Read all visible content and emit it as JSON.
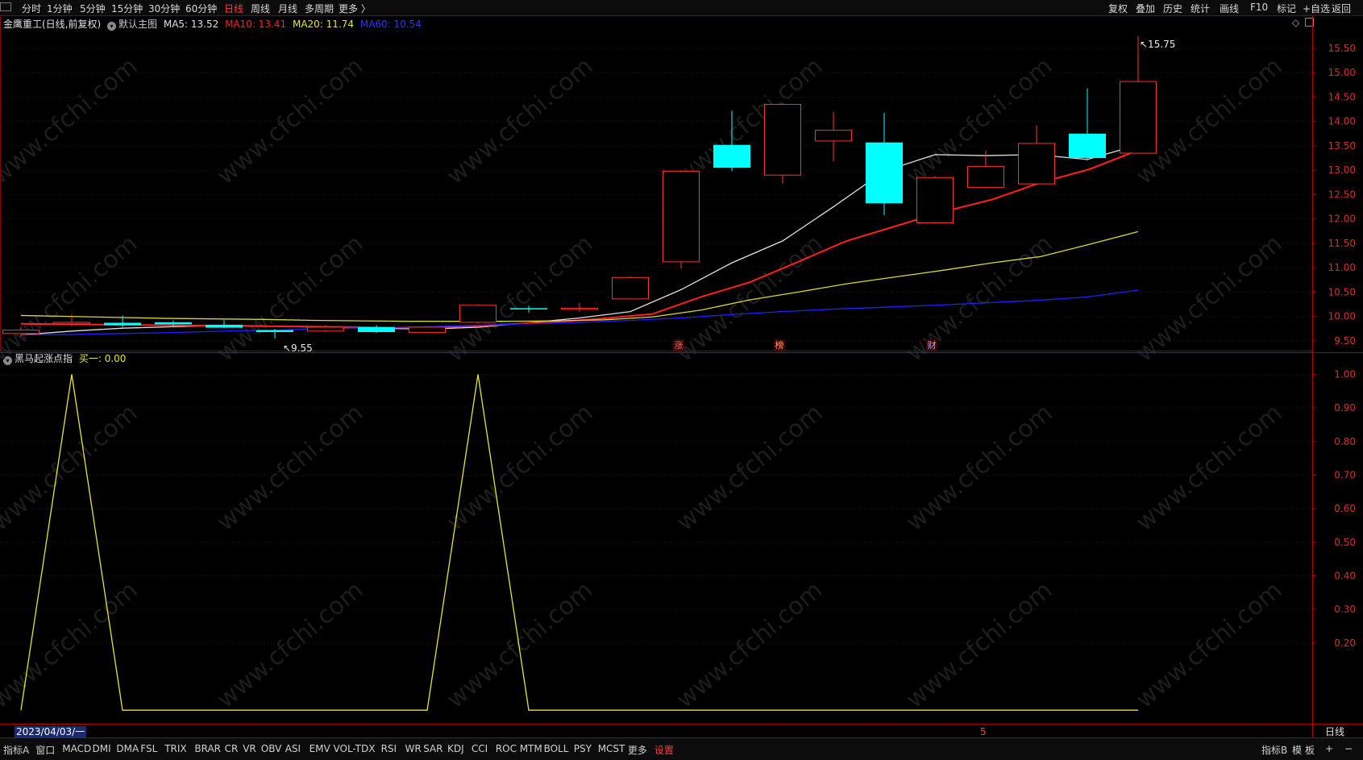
{
  "toolbar": {
    "periods": [
      "分时",
      "1分钟",
      "5分钟",
      "15分钟",
      "30分钟",
      "60分钟",
      "日线",
      "周线",
      "月线",
      "多周期",
      "更多 〉"
    ],
    "active_period": "日线",
    "right_buttons": [
      "复权",
      "叠加",
      "历史",
      "统计",
      "画线",
      "F10",
      "标记",
      "+自选",
      "返回"
    ]
  },
  "main_header": {
    "stock": "金鹰重工(日线,前复权)",
    "main_chart": "默认主图",
    "ma5": "MA5: 13.52",
    "ma10": "MA10: 13.41",
    "ma20": "MA20: 11.74",
    "ma60": "MA60: 10.54"
  },
  "indicator_header": {
    "name": "黑马起涨点指",
    "value": "买一: 0.00"
  },
  "chart_data": [
    {
      "type": "candlestick",
      "title": "金鹰重工(日线,前复权)",
      "yticks": [
        9.5,
        10.0,
        10.5,
        11.0,
        11.5,
        12.0,
        12.5,
        13.0,
        13.5,
        14.0,
        14.5,
        15.0,
        15.5
      ],
      "ylim": [
        9.3,
        15.88
      ],
      "candles": [
        {
          "o": 9.65,
          "c": 9.72,
          "h": 9.78,
          "l": 9.58
        },
        {
          "o": 9.85,
          "c": 9.88,
          "h": 10.05,
          "l": 9.8
        },
        {
          "o": 9.87,
          "c": 9.82,
          "h": 10.02,
          "l": 9.78
        },
        {
          "o": 9.88,
          "c": 9.84,
          "h": 9.92,
          "l": 9.8
        },
        {
          "o": 9.83,
          "c": 9.77,
          "h": 9.93,
          "l": 9.76
        },
        {
          "o": 9.72,
          "c": 9.68,
          "h": 9.74,
          "l": 9.55
        },
        {
          "o": 9.7,
          "c": 9.78,
          "h": 9.82,
          "l": 9.68
        },
        {
          "o": 9.78,
          "c": 9.68,
          "h": 9.82,
          "l": 9.66
        },
        {
          "o": 9.67,
          "c": 9.78,
          "h": 9.8,
          "l": 9.66
        },
        {
          "o": 9.88,
          "c": 10.23,
          "h": 10.25,
          "l": 9.85
        },
        {
          "o": 10.17,
          "c": 10.15,
          "h": 10.22,
          "l": 10.08
        },
        {
          "o": 10.15,
          "c": 10.17,
          "h": 10.28,
          "l": 10.1
        },
        {
          "o": 10.36,
          "c": 10.8,
          "h": 10.82,
          "l": 10.35
        },
        {
          "o": 11.12,
          "c": 12.98,
          "h": 13.0,
          "l": 10.98
        },
        {
          "o": 13.52,
          "c": 13.05,
          "h": 14.22,
          "l": 12.98
        },
        {
          "o": 12.9,
          "c": 14.35,
          "h": 14.38,
          "l": 12.72
        },
        {
          "o": 13.6,
          "c": 13.82,
          "h": 14.2,
          "l": 13.18
        },
        {
          "o": 13.57,
          "c": 12.32,
          "h": 14.18,
          "l": 12.08
        },
        {
          "o": 11.92,
          "c": 12.85,
          "h": 12.88,
          "l": 11.9
        },
        {
          "o": 12.65,
          "c": 13.08,
          "h": 13.4,
          "l": 12.62
        },
        {
          "o": 12.72,
          "c": 13.55,
          "h": 13.92,
          "l": 12.7
        },
        {
          "o": 13.75,
          "c": 13.25,
          "h": 14.68,
          "l": 13.2
        },
        {
          "o": 13.35,
          "c": 14.82,
          "h": 15.75,
          "l": 13.35
        }
      ],
      "series": [
        {
          "name": "MA5",
          "color": "#e0e0e0",
          "values": [
            9.62,
            9.7,
            9.76,
            9.79,
            9.82,
            9.8,
            9.78,
            9.76,
            9.74,
            9.78,
            9.87,
            9.97,
            10.1,
            10.55,
            11.1,
            11.55,
            12.25,
            12.98,
            13.32,
            13.3,
            13.32,
            13.22,
            13.52
          ]
        },
        {
          "name": "MA10",
          "color": "#ff2020",
          "values": [
            9.85,
            9.84,
            9.83,
            9.82,
            9.81,
            9.8,
            9.79,
            9.78,
            9.77,
            9.79,
            9.84,
            9.89,
            9.96,
            10.05,
            10.4,
            10.7,
            11.12,
            11.55,
            11.85,
            12.15,
            12.4,
            12.75,
            13.02,
            13.41
          ]
        },
        {
          "name": "MA20",
          "color": "#d8d838",
          "values": [
            10.02,
            10.0,
            9.98,
            9.96,
            9.95,
            9.94,
            9.92,
            9.91,
            9.9,
            9.9,
            9.9,
            9.91,
            9.93,
            9.99,
            10.13,
            10.34,
            10.5,
            10.67,
            10.81,
            10.95,
            11.1,
            11.23,
            11.48,
            11.74
          ]
        },
        {
          "name": "MA60",
          "color": "#2020ff",
          "values": [
            9.62,
            9.63,
            9.65,
            9.67,
            9.7,
            9.72,
            9.75,
            9.77,
            9.79,
            9.82,
            9.85,
            9.88,
            9.92,
            9.97,
            10.04,
            10.1,
            10.15,
            10.19,
            10.23,
            10.28,
            10.33,
            10.4,
            10.54
          ]
        }
      ],
      "annotations": {
        "high_label": "15.75",
        "low_label": "9.55",
        "markers": [
          "涨",
          "榜",
          "财"
        ]
      }
    },
    {
      "type": "line",
      "title": "黑马起涨点指",
      "yticks": [
        0.2,
        0.3,
        0.4,
        0.5,
        0.6,
        0.7,
        0.8,
        0.9,
        1.0
      ],
      "ylim": [
        -0.05,
        1.03
      ],
      "series": [
        {
          "name": "买一",
          "color": "#e6e632",
          "values": [
            0,
            1,
            0,
            0,
            0,
            0,
            0,
            0,
            0,
            1,
            0,
            0,
            0,
            0,
            0,
            0,
            0,
            0,
            0,
            0,
            0,
            0,
            0
          ]
        }
      ]
    }
  ],
  "xaxis": {
    "date_label": "2023/04/03/一",
    "marker": "5",
    "period": "日线"
  },
  "bottom_tabs": [
    "指标A",
    "窗口",
    "MACD",
    "DMI",
    "DMA",
    "FSL",
    "TRIX",
    "BRAR",
    "CR",
    "VR",
    "OBV",
    "ASI",
    "EMV",
    "VOL-TDX",
    "RSI",
    "WR",
    "SAR",
    "KDJ",
    "CCI",
    "ROC",
    "MTM",
    "BOLL",
    "PSY",
    "MCST",
    "更多",
    "设置"
  ],
  "bottom_right": [
    "指标B",
    "模",
    "板",
    "+",
    "−"
  ],
  "watermark": "www.cfchi.com"
}
